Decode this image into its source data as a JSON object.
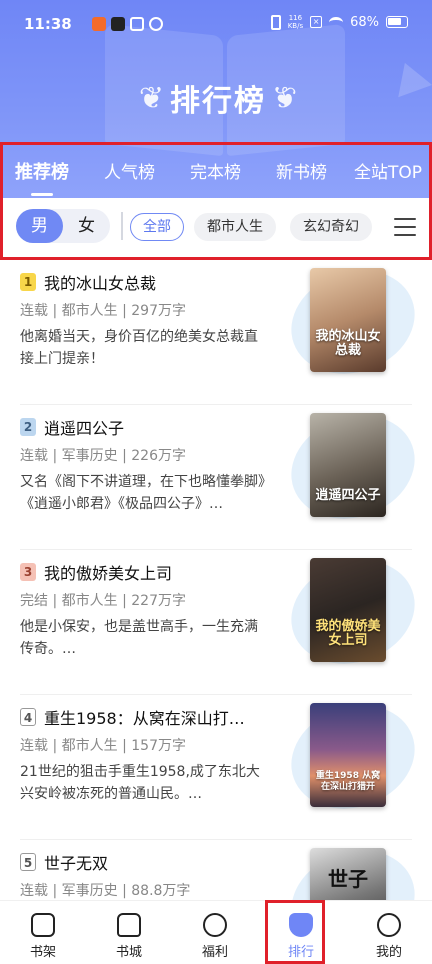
{
  "status": {
    "time": "11:38",
    "net_speed": "116\nKB/s",
    "battery": "68%"
  },
  "header": {
    "logo_text": "排行榜"
  },
  "tabs": [
    "推荐榜",
    "人气榜",
    "完本榜",
    "新书榜",
    "全站TOP"
  ],
  "gender": {
    "male": "男",
    "female": "女"
  },
  "chips": [
    "全部",
    "都市人生",
    "玄幻奇幻"
  ],
  "books": [
    {
      "rank": "1",
      "title": "我的冰山女总裁",
      "status": "连载",
      "genre": "都市人生",
      "words": "297万字",
      "desc": "他离婚当天，身价百亿的绝美女总裁直接上门提亲！",
      "cover_text": "我的冰山女总裁"
    },
    {
      "rank": "2",
      "title": "逍遥四公子",
      "status": "连载",
      "genre": "军事历史",
      "words": "226万字",
      "desc": "又名《阁下不讲道理，在下也略懂拳脚》《逍遥小郎君》《极品四公子》…",
      "cover_text": "逍遥四公子"
    },
    {
      "rank": "3",
      "title": "我的傲娇美女上司",
      "status": "完结",
      "genre": "都市人生",
      "words": "227万字",
      "desc": "他是小保安，也是盖世高手，一生充满传奇。…",
      "cover_text": "我的傲娇美女上司"
    },
    {
      "rank": "4",
      "title": "重生1958：从窝在深山打…",
      "status": "连载",
      "genre": "都市人生",
      "words": "157万字",
      "desc": "21世纪的狙击手重生1958,成了东北大兴安岭被冻死的普通山民。…",
      "cover_text": "重生1958 从窝在深山打猎开"
    },
    {
      "rank": "5",
      "title": "世子无双",
      "status": "连载",
      "genre": "军事历史",
      "words": "88.8万字",
      "desc": "",
      "cover_text": "世子"
    }
  ],
  "bottom_nav": [
    "书架",
    "书城",
    "福利",
    "排行",
    "我的"
  ]
}
